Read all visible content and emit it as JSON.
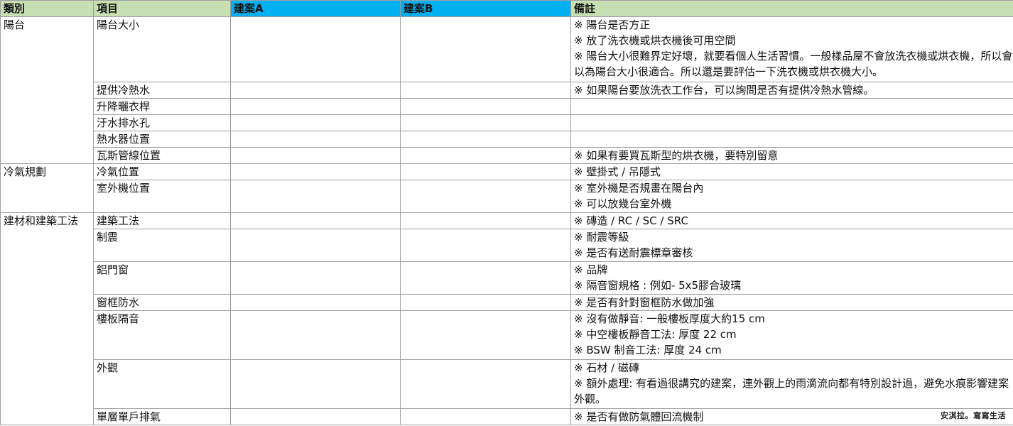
{
  "headers": {
    "category": "類別",
    "item": "項目",
    "case_a": "建案A",
    "case_b": "建案B",
    "note": "備註"
  },
  "rows": [
    {
      "category": "陽台",
      "item": "陽台大小",
      "notes": [
        "※ 陽台是否方正",
        "※ 放了洗衣機或烘衣機後可用空間",
        "※ 陽台大小很難界定好壞，就要看個人生活習慣。一般樣品屋不會放洗衣機或烘衣機，所以會以為陽台大小很適合。所以還是要評估一下洗衣機或烘衣機大小。"
      ]
    },
    {
      "category": "",
      "item": "提供冷熱水",
      "notes": [
        "※ 如果陽台要放洗衣工作台，可以詢問是否有提供冷熱水管線。"
      ]
    },
    {
      "category": "",
      "item": "升降曬衣桿",
      "notes": []
    },
    {
      "category": "",
      "item": "汙水排水孔",
      "notes": []
    },
    {
      "category": "",
      "item": "熱水器位置",
      "notes": []
    },
    {
      "category": "",
      "item": "瓦斯管線位置",
      "notes": [
        "※ 如果有要買瓦斯型的烘衣機，要特別留意"
      ]
    },
    {
      "category": "冷氣規劃",
      "item": "冷氣位置",
      "notes": [
        "※ 壁掛式 / 吊隱式"
      ]
    },
    {
      "category": "",
      "item": "室外機位置",
      "notes": [
        "※  室外機是否規畫在陽台內",
        "※ 可以放幾台室外機"
      ]
    },
    {
      "category": "建材和建築工法",
      "item": "建築工法",
      "notes": [
        "※ 磚造 / RC / SC / SRC"
      ]
    },
    {
      "category": "",
      "item": "制震",
      "notes": [
        "※ 耐震等級",
        "※ 是否有送耐震標章審核"
      ]
    },
    {
      "category": "",
      "item": "鋁門窗",
      "notes": [
        "※ 品牌",
        "※ 隔音窗規格 : 例如- 5x5膠合玻璃"
      ]
    },
    {
      "category": "",
      "item": "窗框防水",
      "notes": [
        "※ 是否有針對窗框防水做加強"
      ]
    },
    {
      "category": "",
      "item": "樓板隔音",
      "notes": [
        "※ 沒有做靜音: 一般樓板厚度大約15 cm",
        "※ 中空樓板靜音工法: 厚度 22 cm",
        "※ BSW 制音工法: 厚度 24 cm"
      ]
    },
    {
      "category": "",
      "item": "外觀",
      "notes": [
        "※ 石材 / 磁磚",
        "※ 額外處理: 有看過很講究的建案，連外觀上的雨滴流向都有特別設計過，避免水痕影響建案外觀。"
      ]
    },
    {
      "category": "",
      "item": "單層單戶排氣",
      "notes": [
        "※ 是否有做防氣體回流機制"
      ]
    }
  ],
  "watermark": "安淇拉。寫寫生活"
}
